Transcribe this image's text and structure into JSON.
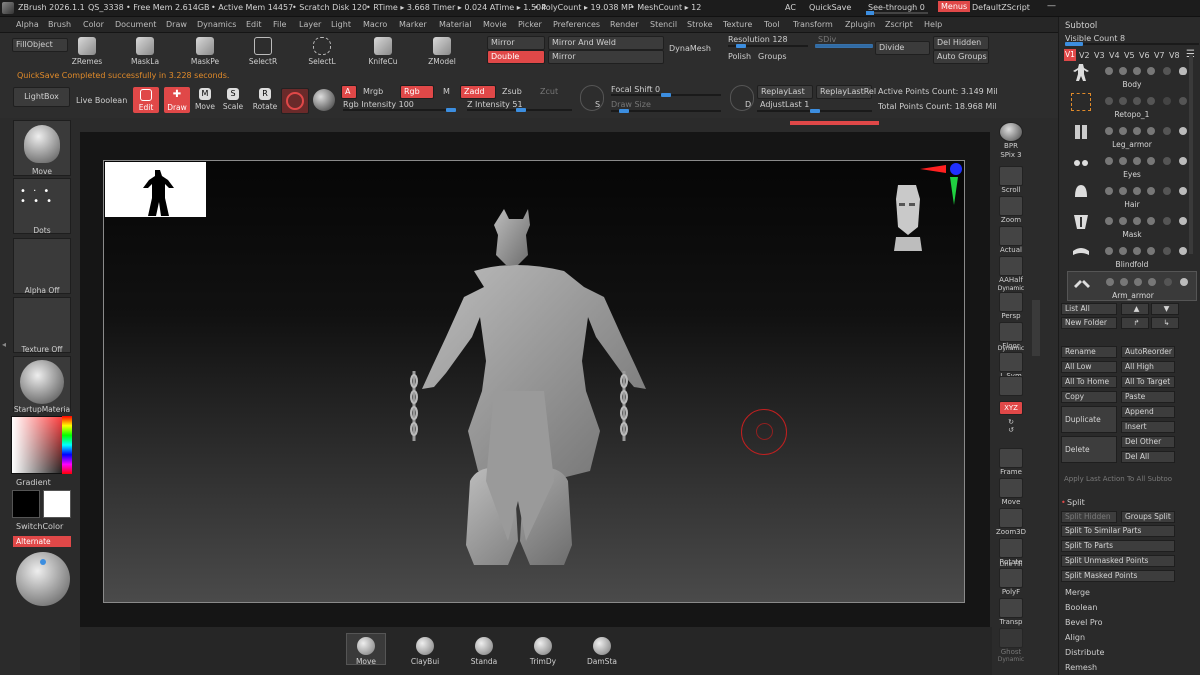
{
  "titlebar": {
    "app": "ZBrush 2026.1.1",
    "doc": "QS_3338",
    "free_mem": "• Free Mem 2.614GB",
    "active_mem": "• Active Mem 14457",
    "scratch": "• Scratch Disk 120",
    "rtime": "• RTime ▸ 3.668 Timer ▸ 0.024 ATime ▸ 1.504",
    "polycount": "• PolyCount ▸ 19.038 MP",
    "meshcount": "• MeshCount ▸ 12",
    "ac": "AC",
    "quicksave": "QuickSave",
    "see_through": "See-through  0",
    "menus": "Menus",
    "script": "DefaultZScript"
  },
  "menu": [
    "Alpha",
    "Brush",
    "Color",
    "Document",
    "Draw",
    "Dynamics",
    "Edit",
    "File",
    "Layer",
    "Light",
    "Macro",
    "Marker",
    "Material",
    "Movie",
    "Picker",
    "Preferences",
    "Render",
    "Stencil",
    "Stroke",
    "Texture",
    "Tool",
    "Transform",
    "Zplugin",
    "Zscript",
    "Help"
  ],
  "toolbar": {
    "fillobject": "FillObject",
    "quicksave_msg": "QuickSave Completed successfully in 3.228 seconds.",
    "tools": [
      "ZRemes",
      "MaskLa",
      "MaskPe",
      "SelectR",
      "SelectL",
      "KnifeCu",
      "ZModel"
    ],
    "mirror": "Mirror",
    "mirror_weld": "Mirror And Weld",
    "double": "Double",
    "mirror2": "Mirror",
    "dynamesh": "DynaMesh",
    "resolution": "Resolution 128",
    "sdiv": "SDiv",
    "divide": "Divide",
    "del_hidden": "Del Hidden",
    "polish": "Polish",
    "groups": "Groups",
    "auto_groups": "Auto Groups",
    "lightbox": "LightBox",
    "live_boolean": "Live Boolean",
    "edit": "Edit",
    "draw": "Draw",
    "move": "Move",
    "scale": "Scale",
    "rotate": "Rotate",
    "a": "A",
    "mrgb": "Mrgb",
    "rgb": "Rgb",
    "m": "M",
    "zadd": "Zadd",
    "zsub": "Zsub",
    "zcut": "Zcut",
    "rgb_intensity": "Rgb Intensity 100",
    "z_intensity": "Z Intensity 51",
    "focal_shift": "Focal Shift 0",
    "draw_size": "Draw Size",
    "s": "S",
    "d": "D",
    "replay_last": "ReplayLast",
    "replay_last_rel": "ReplayLastRel",
    "adjust_last": "AdjustLast 1",
    "active_points": "Active Points Count: 3.149 Mil",
    "total_points": "Total Points Count: 18.968 Mil",
    "rgb_intensity_value": 1.0,
    "z_intensity_value": 0.51,
    "focal_value": 0.5,
    "draw_size_value": 0.12,
    "adjust_value": 0.5
  },
  "left": {
    "brush": "Move",
    "stroke": "Dots",
    "alpha": "Alpha Off",
    "texture": "Texture Off",
    "material": "StartupMateria",
    "gradient": "Gradient",
    "switchcolor": "SwitchColor",
    "alternate": "Alternate"
  },
  "shelf": {
    "bpr": "BPR",
    "spix": "SPix 3",
    "scroll": "Scroll",
    "zoom": "Zoom",
    "actual": "Actual",
    "aahalf": "AAHalf",
    "dynamic": "Dynamic",
    "persp": "Persp",
    "floor": "Floor",
    "dynamic2": "Dynamic",
    "lsym": "L.Sym",
    "xyz": "XYZ",
    "frame": "Frame",
    "move": "Move",
    "zoom3d": "Zoom3D",
    "rotate": "Rotate",
    "line_fill": "Line Fill",
    "polyf": "PolyF",
    "transp": "Transp",
    "ghost": "Ghost",
    "dynamic3": "Dynamic"
  },
  "subtool": {
    "title": "Subtool",
    "visible_count": "Visible Count 8",
    "versions": [
      "V1",
      "V2",
      "V3",
      "V4",
      "V5",
      "V6",
      "V7",
      "V8"
    ],
    "items": [
      "Body",
      "Retopo_1",
      "Leg_armor",
      "Eyes",
      "Hair",
      "Mask",
      "Blindfold",
      "Arm_armor"
    ],
    "list_all": "List All",
    "new_folder": "New Folder",
    "rename": "Rename",
    "autoreorder": "AutoReorder",
    "all_low": "All Low",
    "all_high": "All High",
    "all_to_home": "All To Home",
    "all_to_target": "All To Target",
    "copy": "Copy",
    "paste": "Paste",
    "duplicate": "Duplicate",
    "append": "Append",
    "insert": "Insert",
    "delete": "Delete",
    "del_other": "Del Other",
    "del_all": "Del All",
    "apply_last": "Apply Last Action To All Subtoo",
    "split": "Split",
    "split_hidden": "Split Hidden",
    "groups_split": "Groups Split",
    "split_similar": "Split To Similar Parts",
    "split_parts": "Split To Parts",
    "split_unmasked": "Split Unmasked Points",
    "split_masked": "Split Masked Points",
    "merge": "Merge",
    "boolean": "Boolean",
    "bevel_pro": "Bevel Pro",
    "align": "Align",
    "distribute": "Distribute",
    "remesh": "Remesh"
  },
  "bottom": [
    "Move",
    "ClayBui",
    "Standa",
    "TrimDy",
    "DamSta"
  ],
  "colors": {
    "accent": "#e04848",
    "slider": "#3c8ee0",
    "orange": "#e08a2a"
  }
}
